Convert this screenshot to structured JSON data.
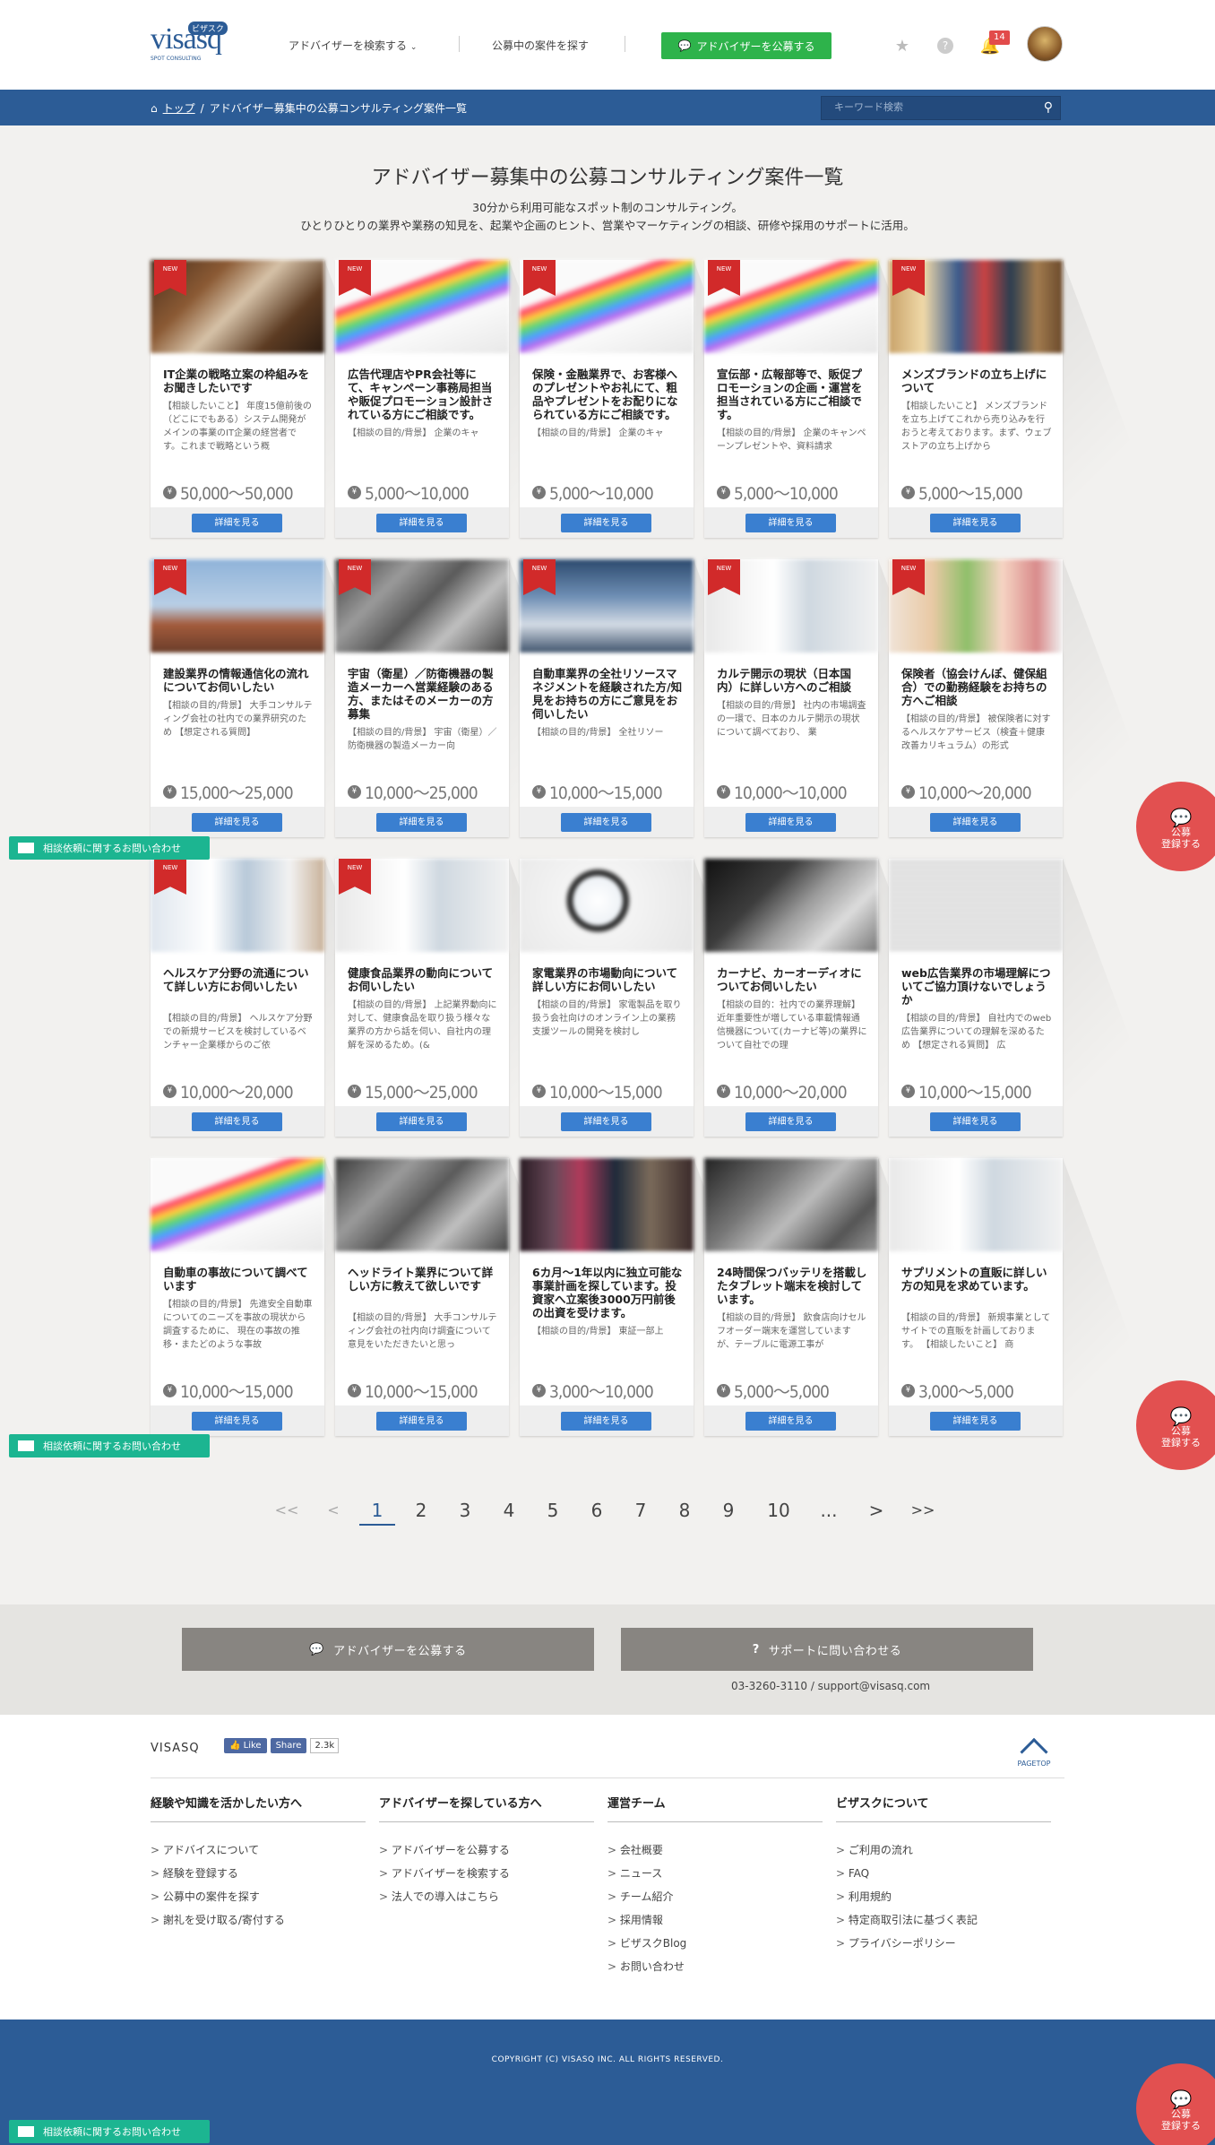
{
  "header": {
    "logo_text": "visasq",
    "logo_badge": "ビザスク",
    "logo_sub": "SPOT CONSULTING",
    "nav_search": "アドバイザーを検索する",
    "nav_projects": "公募中の案件を探す",
    "publish_button": "アドバイザーを公募する",
    "notification_count": "14"
  },
  "breadcrumb": {
    "home": "トップ",
    "current": "アドバイザー募集中の公募コンサルティング案件一覧"
  },
  "search": {
    "placeholder": "キーワード検索"
  },
  "page": {
    "title": "アドバイザー募集中の公募コンサルティング案件一覧",
    "desc1": "30分から利用可能なスポット制のコンサルティング。",
    "desc2": "ひとりひとりの業界や業務の知見を、起業や企画のヒント、営業やマーケティングの相談、研修や採用のサポートに活用。"
  },
  "detail_label": "詳細を見る",
  "new_label": "NEW",
  "cards": [
    {
      "title": "IT企業の戦略立案の枠組みをお聞きしたいです",
      "desc": "【相談したいこと】 年度15億前後の（どこにでもある）システム開発がメインの事業のIT企業の経営者です。これまで戦略という概",
      "price": "50,000〜50,000",
      "new": true,
      "img": "desk"
    },
    {
      "title": "広告代理店やPR会社等にて、キャンペーン事務局担当や販促プロモーション設計されている方にご相談です。",
      "desc": "【相談の目的/背景】 企業のキャ",
      "price": "5,000〜10,000",
      "new": true,
      "img": "chart"
    },
    {
      "title": "保険・金融業界で、お客様へのプレゼントやお礼にて、粗品やプレゼントをお配りになられている方にご相談です。",
      "desc": "【相談の目的/背景】 企業のキャ",
      "price": "5,000〜10,000",
      "new": true,
      "img": "chart"
    },
    {
      "title": "宣伝部・広報部等で、販促プロモーションの企画・運営を担当されている方にご相談です。",
      "desc": "【相談の目的/背景】 企業のキャンペーンプレゼントや、資料請求",
      "price": "5,000〜10,000",
      "new": true,
      "img": "chart"
    },
    {
      "title": "メンズブランドの立ち上げについて",
      "desc": "【相談したいこと】 メンズブランドを立ち上げてこれから売り込みを行おうと考えております。まず、ウェブストアの立ち上げから",
      "price": "5,000〜15,000",
      "new": true,
      "img": "clothes"
    },
    {
      "title": "建設業界の情報通信化の流れについてお伺いしたい",
      "desc": "【相談の目的/背景】 大手コンサルティング会社の社内での業界研究のため 【想定される質問】",
      "price": "15,000〜25,000",
      "new": true,
      "img": "crane"
    },
    {
      "title": "宇宙（衛星）／防衛機器の製造メーカーへ営業経験のある方、またはそのメーカーの方募集",
      "desc": "【相談の目的/背景】 宇宙（衛星）／防衛機器の製造メーカー向",
      "price": "10,000〜25,000",
      "new": true,
      "img": "factory"
    },
    {
      "title": "自動車業界の全社リソースマネジメントを経験された方/知見をお持ちの方にご意見をお伺いしたい",
      "desc": "【相談の目的/背景】 全社リソー",
      "price": "10,000〜15,000",
      "new": true,
      "img": "office"
    },
    {
      "title": "カルテ開示の現状（日本国内）に詳しい方へのご相談",
      "desc": "【相談の目的/背景】 社内の市場調査の一環で、日本のカルテ開示の現状について調べており、 業",
      "price": "10,000〜10,000",
      "new": true,
      "img": "doctor"
    },
    {
      "title": "保険者（協会けんぽ、健保組合）での勤務経験をお持ちの方へご相談",
      "desc": "【相談の目的/背景】 被保険者に対するヘルスケアサービス（検査＋健康改善カリキュラム）の形式",
      "price": "10,000〜20,000",
      "new": true,
      "img": "family"
    },
    {
      "title": "ヘルスケア分野の流通について詳しい方にお伺いしたい",
      "desc": "【相談の目的/背景】 ヘルスケア分野での新規サービスを検討しているベンチャー企業様からのご依",
      "price": "10,000〜20,000",
      "new": true,
      "img": "doctor2"
    },
    {
      "title": "健康食品業界の動向についてお伺いしたい",
      "desc": "【相談の目的/背景】 上記業界動向に対して、健康食品を取り扱う様々な業界の方から話を伺い、自社内の理解を深めるため。(&",
      "price": "15,000〜25,000",
      "new": true,
      "img": "doctor"
    },
    {
      "title": "家電業界の市場動向について詳しい方にお伺いしたい",
      "desc": "【相談の目的/背景】 家電製品を取り扱う会社向けのオンライン上の業務支援ツールの開発を検討し",
      "price": "10,000〜15,000",
      "new": false,
      "img": "magnifier"
    },
    {
      "title": "カーナビ、カーオーディオについてお伺いしたい",
      "desc": "【相談の目的：社内での業界理解】 近年重要性が増している車載情報通信機器について(カーナビ等)の業界について自社での理",
      "price": "10,000〜20,000",
      "new": false,
      "img": "car"
    },
    {
      "title": "web広告業界の市場理解についてご協力頂けないでしょうか",
      "desc": "【相談の目的/背景】 自社内でのweb広告業界についての理解を深めるため 【想定される質問】 広",
      "price": "10,000〜15,000",
      "new": false,
      "img": "newspaper"
    },
    {
      "title": "自動車の事故について調べています",
      "desc": "【相談の目的/背景】 先進安全自動車についてのニーズを事故の現状から調査するために、 現在の事故の推移・またどのような事故",
      "price": "10,000〜15,000",
      "new": false,
      "img": "chart"
    },
    {
      "title": "ヘッドライト業界について詳しい方に教えて欲しいです",
      "desc": "【相談の目的/背景】 大手コンサルティング会社の社内向け調査について意見をいただきたいと思っ",
      "price": "10,000〜15,000",
      "new": false,
      "img": "factory"
    },
    {
      "title": "6カ月〜1年以内に独立可能な事業計画を探しています。投資家へ立案後3000万円前後の出資を受けます。",
      "desc": "【相談の目的/背景】 東証一部上",
      "price": "3,000〜10,000",
      "new": false,
      "img": "crowd"
    },
    {
      "title": "24時間保つバッテリを搭載したタブレット端末を検討しています。",
      "desc": "【相談の目的/背景】 飲食店向けセルフオーダー端末を運営していますが、テーブルに電源工事が",
      "price": "5,000〜5,000",
      "new": false,
      "img": "factory2"
    },
    {
      "title": "サプリメントの直販に詳しい方の知見を求めています。",
      "desc": "【相談の目的/背景】 新規事業としてサイトでの直販を計画しております。 【相談したいこと】 商",
      "price": "3,000〜5,000",
      "new": false,
      "img": "doctor"
    }
  ],
  "pagination": {
    "first": "<<",
    "prev": "<",
    "pages": [
      "1",
      "2",
      "3",
      "4",
      "5",
      "6",
      "7",
      "8",
      "9",
      "10",
      "..."
    ],
    "next": ">",
    "last": ">>",
    "current": "1"
  },
  "cta": {
    "publish": "アドバイザーを公募する",
    "support": "サポートに問い合わせる",
    "contact": "03-3260-3110 / support@visasq.com"
  },
  "footer": {
    "brand": "VISASQ",
    "like": "Like",
    "share": "Share",
    "share_count": "2.3k",
    "pagetop": "PAGETOP",
    "columns": [
      {
        "heading": "経験や知識を活かしたい方へ",
        "items": [
          "アドバイスについて",
          "経験を登録する",
          "公募中の案件を探す",
          "謝礼を受け取る/寄付する"
        ]
      },
      {
        "heading": "アドバイザーを探している方へ",
        "items": [
          "アドバイザーを公募する",
          "アドバイザーを検索する",
          "法人での導入はこちら"
        ]
      },
      {
        "heading": "運営チーム",
        "items": [
          "会社概要",
          "ニュース",
          "チーム紹介",
          "採用情報",
          "ビザスクBlog",
          "お問い合わせ"
        ]
      },
      {
        "heading": "ビザスクについて",
        "items": [
          "ご利用の流れ",
          "FAQ",
          "利用規約",
          "特定商取引法に基づく表記",
          "プライバシーポリシー"
        ]
      }
    ],
    "copyright": "COPYRIGHT (C) VISASQ INC. ALL RIGHTS RESERVED."
  },
  "floating": {
    "inquiry": "相談依頼に関するお問い合わせ",
    "register_line1": "公募",
    "register_line2": "登録する"
  },
  "colors": {
    "brand": "#2c5c96",
    "green": "#2eb34b",
    "button": "#3a7fd0",
    "new": "#d12a2a",
    "teal": "#1cb591",
    "register": "#e25050"
  }
}
